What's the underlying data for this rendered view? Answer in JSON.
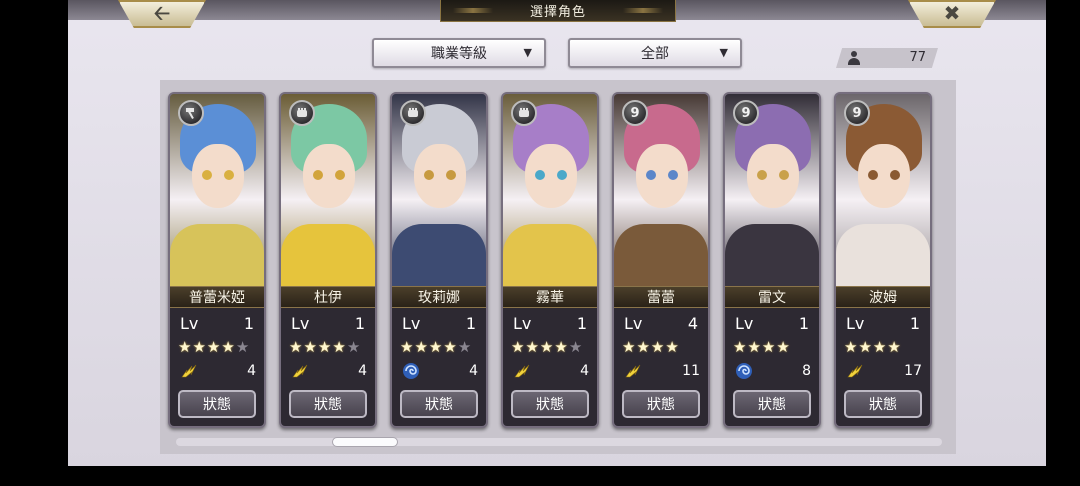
{
  "header": {
    "title": "選擇角色",
    "back_icon": "arrow-left-icon",
    "close_icon": "x-icon"
  },
  "filters": {
    "class_level": {
      "label": "職業等級",
      "icon": "triangle-down-icon"
    },
    "category": {
      "label": "全部",
      "icon": "triangle-down-icon"
    }
  },
  "roster_count": {
    "icon": "user-icon",
    "value": "77"
  },
  "status_label": "狀態",
  "level_label": "Lv",
  "characters": [
    {
      "name": "普蕾米婭",
      "level": "1",
      "stars_filled": 4,
      "stars_total": 5,
      "element": "lightning",
      "stat": "4",
      "badge": "hammer",
      "hair": "#5b8fd6",
      "eye": "#d9b040",
      "outfit": "#d7c35a"
    },
    {
      "name": "杜伊",
      "level": "1",
      "stars_filled": 4,
      "stars_total": 5,
      "element": "lightning",
      "stat": "4",
      "badge": "gauntlet",
      "hair": "#7cc8a4",
      "eye": "#d2a43b",
      "outfit": "#e6c43c"
    },
    {
      "name": "玫莉娜",
      "level": "1",
      "stars_filled": 4,
      "stars_total": 5,
      "element": "wind",
      "stat": "4",
      "badge": "gauntlet",
      "hair": "#c9cbd4",
      "eye": "#c79a3f",
      "outfit": "#3d4b72"
    },
    {
      "name": "霧華",
      "level": "1",
      "stars_filled": 4,
      "stars_total": 5,
      "element": "lightning",
      "stat": "4",
      "badge": "gauntlet",
      "hair": "#a77ec8",
      "eye": "#4aa8c9",
      "outfit": "#e3c44b"
    },
    {
      "name": "蕾蕾",
      "level": "4",
      "stars_filled": 4,
      "stars_total": 4,
      "element": "lightning",
      "stat": "11",
      "badge": "9",
      "hair": "#c86a8d",
      "eye": "#5b86c9",
      "outfit": "#7a5a3a"
    },
    {
      "name": "雷文",
      "level": "1",
      "stars_filled": 4,
      "stars_total": 4,
      "element": "wind",
      "stat": "8",
      "badge": "9",
      "hair": "#8c6db1",
      "eye": "#c9a14a",
      "outfit": "#3a3540"
    },
    {
      "name": "波姆",
      "level": "1",
      "stars_filled": 4,
      "stars_total": 4,
      "element": "lightning",
      "stat": "17",
      "badge": "9",
      "hair": "#8b5a34",
      "eye": "#8a5a32",
      "outfit": "#e9e1dc"
    }
  ]
}
